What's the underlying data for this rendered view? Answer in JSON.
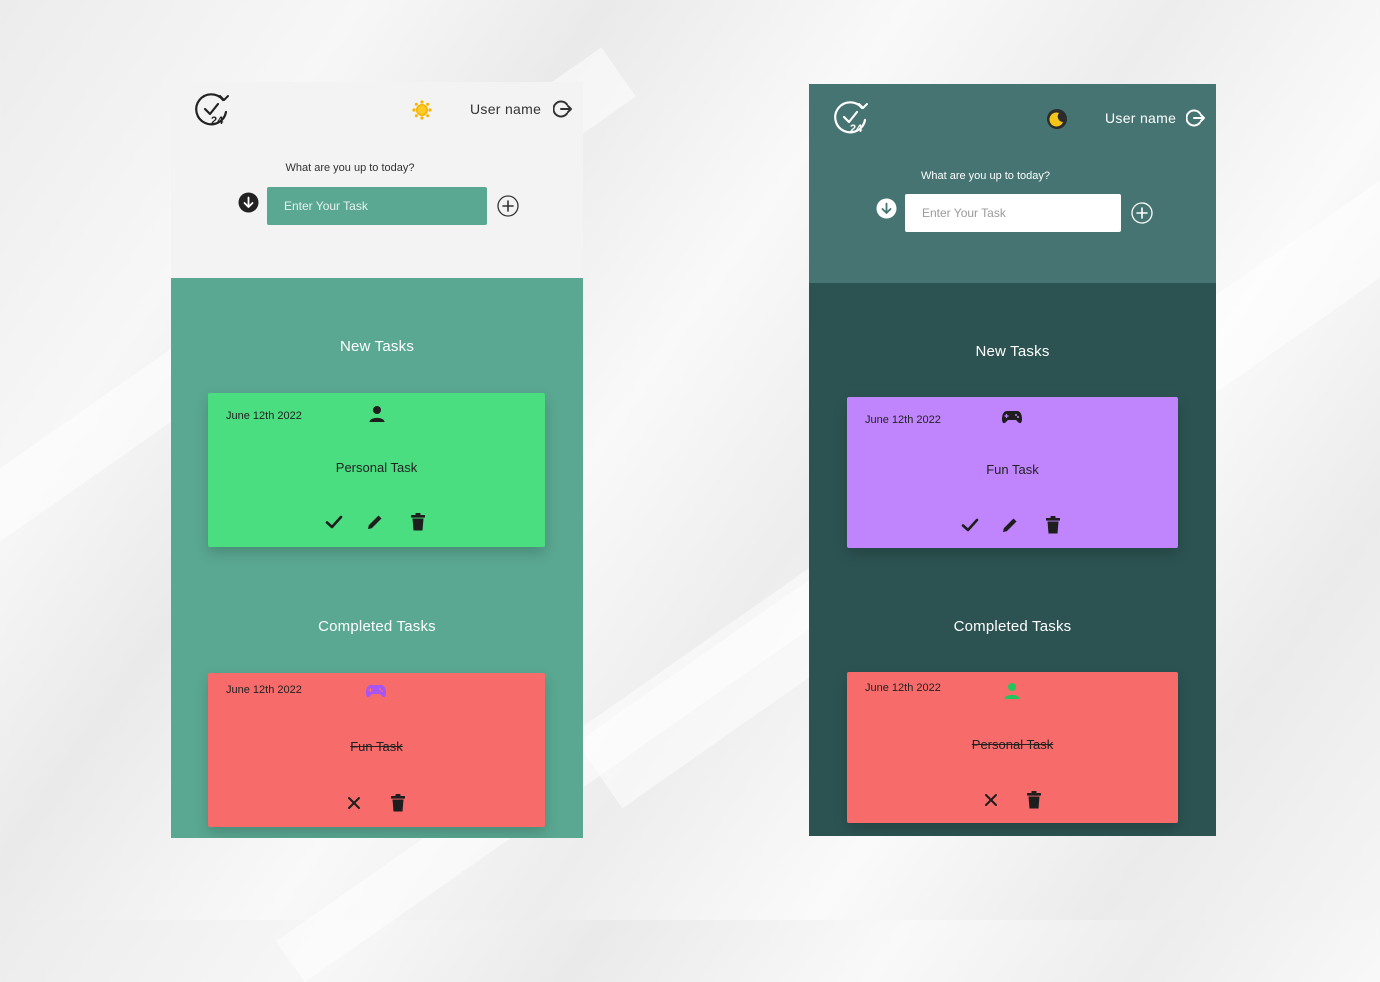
{
  "light": {
    "header": {
      "username": "User name",
      "prompt": "What are you up to today?",
      "input_placeholder": "Enter Your Task",
      "logo_icon": "clock-24-icon",
      "theme_icon": "sun-icon"
    },
    "new_section": {
      "title": "New Tasks",
      "card": {
        "date": "June 12th 2022",
        "title": "Personal Task",
        "category_icon": "person-icon",
        "color": "#4ade80"
      }
    },
    "completed_section": {
      "title": "Completed Tasks",
      "card": {
        "date": "June 12th 2022",
        "title": "Fun Task",
        "category_icon": "gamepad-icon",
        "color": "#f76b6b"
      }
    },
    "colors": {
      "header": "#f3f3f3",
      "body": "#5aa892",
      "input": "#5aa892"
    }
  },
  "dark": {
    "header": {
      "username": "User name",
      "prompt": "What are you up to today?",
      "input_placeholder": "Enter Your Task",
      "logo_icon": "clock-24-icon",
      "theme_icon": "moon-icon"
    },
    "new_section": {
      "title": "New Tasks",
      "card": {
        "date": "June 12th 2022",
        "title": "Fun Task",
        "category_icon": "gamepad-icon",
        "color": "#c084fc"
      }
    },
    "completed_section": {
      "title": "Completed Tasks",
      "card": {
        "date": "June 12th 2022",
        "title": "Personal Task",
        "category_icon": "person-icon",
        "color": "#f76b6b"
      }
    },
    "colors": {
      "header": "#457472",
      "body": "#2c5352",
      "input": "#ffffff"
    }
  }
}
